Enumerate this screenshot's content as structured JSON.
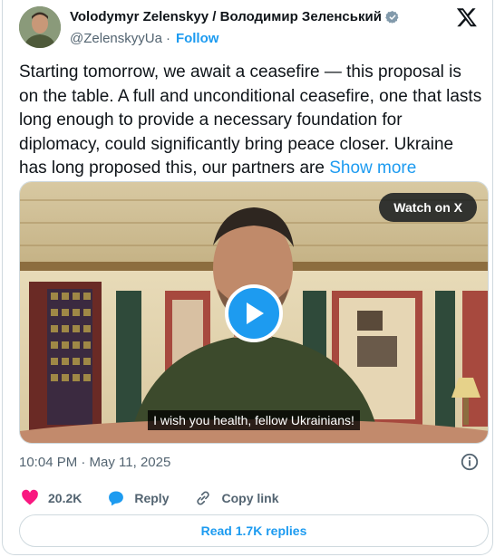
{
  "author": {
    "name": "Volodymyr Zelenskyy / Володимир Зеленський",
    "handle": "@ZelenskyyUa",
    "separator": "·",
    "follow_label": "Follow"
  },
  "tweet": {
    "text": "Starting tomorrow, we await a ceasefire — this proposal is on the table. A full and unconditional ceasefire, one that lasts long enough to provide a necessary foundation for diplomacy, could significantly bring peace closer. Ukraine has long proposed this, our partners are ",
    "show_more": "Show more"
  },
  "media": {
    "watch_label": "Watch on X",
    "caption": "I wish you health, fellow Ukrainians!"
  },
  "meta": {
    "timestamp": "10:04 PM · May 11, 2025"
  },
  "actions": {
    "likes": "20.2K",
    "reply_label": "Reply",
    "copy_link_label": "Copy link"
  },
  "replies": {
    "label": "Read 1.7K replies"
  },
  "colors": {
    "accent": "#1d9bf0",
    "like": "#f91880",
    "text": "#0f1419",
    "muted": "#536471"
  }
}
